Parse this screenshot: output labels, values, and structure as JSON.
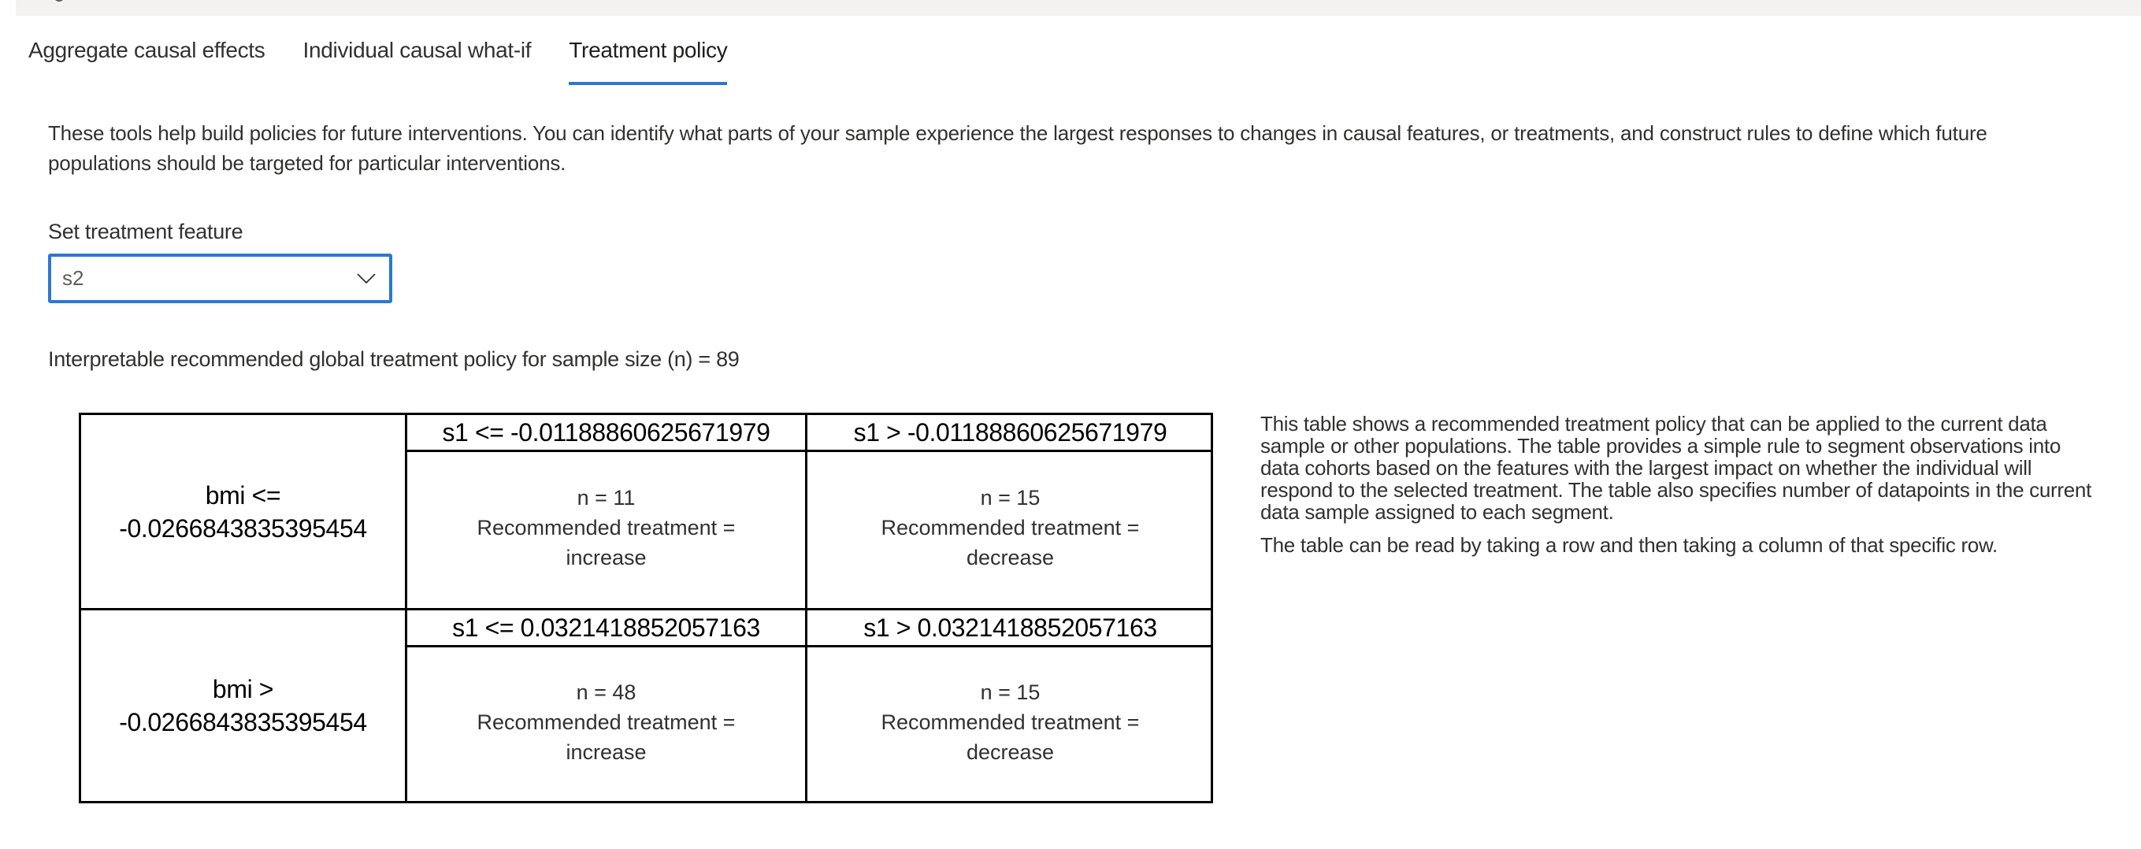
{
  "tabs": [
    {
      "label": "Aggregate causal effects",
      "active": false
    },
    {
      "label": "Individual causal what-if",
      "active": false
    },
    {
      "label": "Treatment policy",
      "active": true
    }
  ],
  "description": "These tools help build policies for future interventions. You can identify what parts of your sample experience the largest responses to changes in causal features, or treatments, and construct rules to define which future populations should be targeted for particular interventions.",
  "treatment_feature": {
    "label": "Set treatment feature",
    "selected": "s2"
  },
  "policy_title": "Interpretable recommended global treatment policy for sample size (n) = 89",
  "policy_table": {
    "rows": [
      {
        "label": "bmi <= -0.0266843835395454",
        "columns": [
          {
            "header": "s1 <= -0.01188860625671979",
            "n": "n = 11",
            "treatment_line1": "Recommended treatment =",
            "treatment_line2": "increase"
          },
          {
            "header": "s1 > -0.01188860625671979",
            "n": "n = 15",
            "treatment_line1": "Recommended treatment =",
            "treatment_line2": "decrease"
          }
        ]
      },
      {
        "label": "bmi > -0.0266843835395454",
        "columns": [
          {
            "header": "s1 <= 0.0321418852057163",
            "n": "n = 48",
            "treatment_line1": "Recommended treatment =",
            "treatment_line2": "increase"
          },
          {
            "header": "s1 > 0.0321418852057163",
            "n": "n = 15",
            "treatment_line1": "Recommended treatment =",
            "treatment_line2": "decrease"
          }
        ]
      }
    ]
  },
  "side_note": {
    "paragraph1": "This table shows a recommended treatment policy that can be applied to the current data sample or other populations. The table provides a simple rule to segment observations into data cohorts based on the features with the largest impact on whether the individual will respond to the selected treatment. The table also specifies number of datapoints in the current data sample assigned to each segment.",
    "paragraph2": "The table can be read by taking a row and then taking a column of that specific row."
  },
  "colors": {
    "accent": "#2b78d0",
    "text": "#323130",
    "strip": "#f3f2f1"
  }
}
